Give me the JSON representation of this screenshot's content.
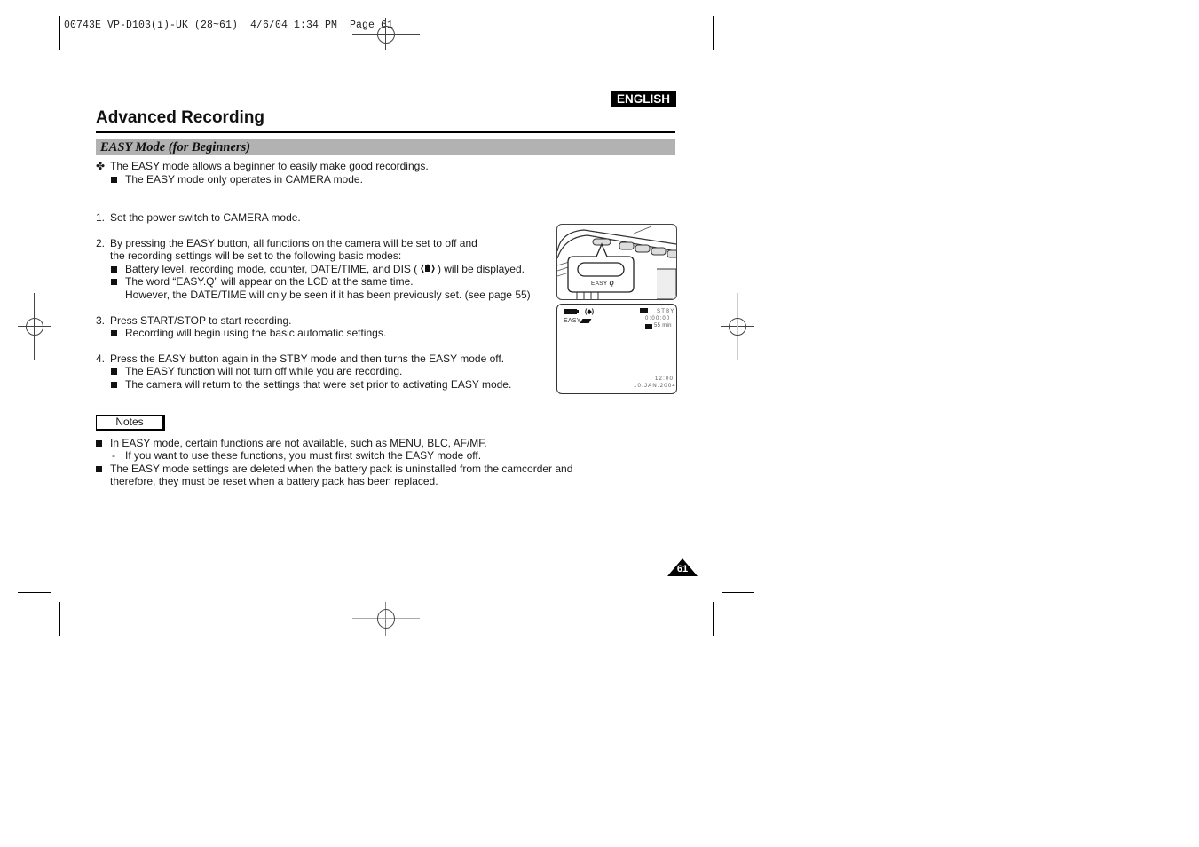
{
  "print_header": "00743E VP-D103(i)-UK (28~61)  4/6/04 1:34 PM  Page 61",
  "language_badge": "ENGLISH",
  "page_title": "Advanced Recording",
  "section_title": "EASY Mode (for Beginners)",
  "intro": {
    "lead": "The EASY mode allows a beginner to easily make good recordings.",
    "sub": "The EASY mode only operates in CAMERA mode."
  },
  "steps": [
    {
      "number": "1.",
      "lines": [
        "Set the power switch to CAMERA mode."
      ],
      "bullets": []
    },
    {
      "number": "2.",
      "lines": [
        "By pressing the EASY button, all functions on the camera will be set to off and",
        "the recording settings will be set to the following basic modes:"
      ],
      "bullets": [
        {
          "pre": "Battery level, recording mode, counter, DATE/TIME, and DIS (",
          "icon": "dis-icon",
          "post": ") will be displayed."
        },
        {
          "text": "The word “EASY.Q” will appear on the LCD at the same time.",
          "continuation": "However, the DATE/TIME will only be seen if it has been previously set. (see page 55)"
        }
      ]
    },
    {
      "number": "3.",
      "lines": [
        "Press START/STOP to start recording."
      ],
      "bullets": [
        {
          "text": "Recording will begin using the basic automatic settings."
        }
      ]
    },
    {
      "number": "4.",
      "lines": [
        "Press the EASY button again in the STBY mode and then turns the EASY mode off."
      ],
      "bullets": [
        {
          "text": "The EASY function will not turn off while you are recording."
        },
        {
          "text": "The camera will return to the settings that were set prior to activating EASY mode."
        }
      ]
    }
  ],
  "notes": {
    "label": "Notes",
    "items": [
      {
        "text": "In EASY mode, certain functions are not available, such as MENU, BLC, AF/MF.",
        "dash": "If you want to use these functions, you must first switch the EASY mode off."
      },
      {
        "text": "The EASY mode settings are deleted when the battery pack is uninstalled from the camcorder and",
        "continuation": "therefore, they must be reset when a battery pack has been replaced."
      }
    ]
  },
  "figure_button": {
    "label": "EASY"
  },
  "figure_lcd": {
    "status": "STBY",
    "counter": "0:00:00",
    "remaining": "55 min",
    "easy_label": "EASY",
    "time": "12:00",
    "date": "10.JAN.2004"
  },
  "page_number": "61"
}
